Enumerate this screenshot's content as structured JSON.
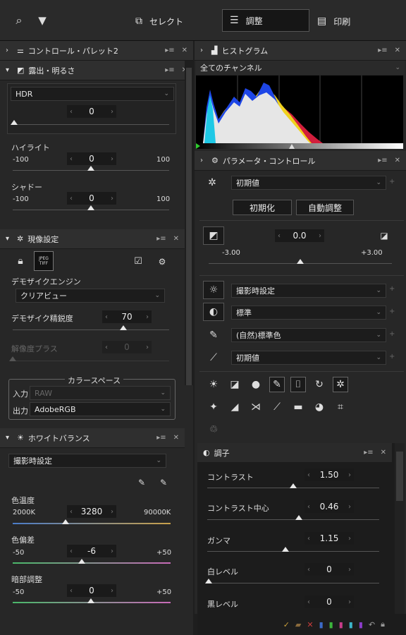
{
  "topbar": {
    "select": "セレクト",
    "adjust": "調整",
    "print": "印刷"
  },
  "left": {
    "palette2": "コントロール・パレット2",
    "exposure": {
      "title": "露出・明るさ",
      "mode": "HDR",
      "value": "0",
      "highlight_label": "ハイライト",
      "highlight_min": "-100",
      "highlight_value": "0",
      "highlight_max": "100",
      "highlight_level": 0.5,
      "shadow_label": "シャドー",
      "shadow_min": "-100",
      "shadow_value": "0",
      "shadow_max": "100",
      "shadow_level": 0.5,
      "hdr_level": 0.0
    },
    "develop": {
      "title": "現像設定",
      "jpeg_label": "JPEG TIFF",
      "demosaic_label": "デモザイクエンジン",
      "demosaic_value": "クリアビュー",
      "precision_label": "デモザイク精鋭度",
      "precision_value": "70",
      "precision_level": 0.7,
      "resolution_label": "解像度プラス",
      "resolution_value": "0",
      "colorspace_title": "カラースペース",
      "input_label": "入力",
      "input_value": "RAW",
      "output_label": "出力",
      "output_value": "AdobeRGB"
    },
    "wb": {
      "title": "ホワイトバランス",
      "mode": "撮影時設定",
      "temp_label": "色温度",
      "temp_min": "2000K",
      "temp_value": "3280",
      "temp_max": "90000K",
      "temp_level": 0.3,
      "tint_label": "色偏差",
      "tint_min": "-50",
      "tint_value": "-6",
      "tint_max": "+50",
      "tint_level": 0.44,
      "dark_label": "暗部調整",
      "dark_min": "-50",
      "dark_value": "0",
      "dark_max": "+50",
      "dark_level": 0.5
    }
  },
  "right": {
    "histogram": {
      "title": "ヒストグラム",
      "channel": "全てのチャンネル"
    },
    "params": {
      "title": "パラメータ・コントロール",
      "preset": "初期値",
      "init_button": "初期化",
      "auto_button": "自動調整",
      "exposure_value": "0.0",
      "exp_min": "-3.00",
      "exp_max": "+3.00",
      "exp_level": 0.5,
      "row1": "撮影時設定",
      "row2": "標準",
      "row3": "(自然)標準色",
      "row4": "初期値"
    },
    "tone": {
      "title": "調子",
      "contrast_label": "コントラスト",
      "contrast_value": "1.50",
      "contrast_level": 0.49,
      "contrast_center_label": "コントラスト中心",
      "contrast_center_value": "0.46",
      "contrast_center_level": 0.5,
      "gamma_label": "ガンマ",
      "gamma_value": "1.15",
      "gamma_level": 0.42,
      "white_label": "白レベル",
      "white_value": "0",
      "white_level": 0.0,
      "black_label": "黒レベル",
      "black_value": "0"
    }
  }
}
